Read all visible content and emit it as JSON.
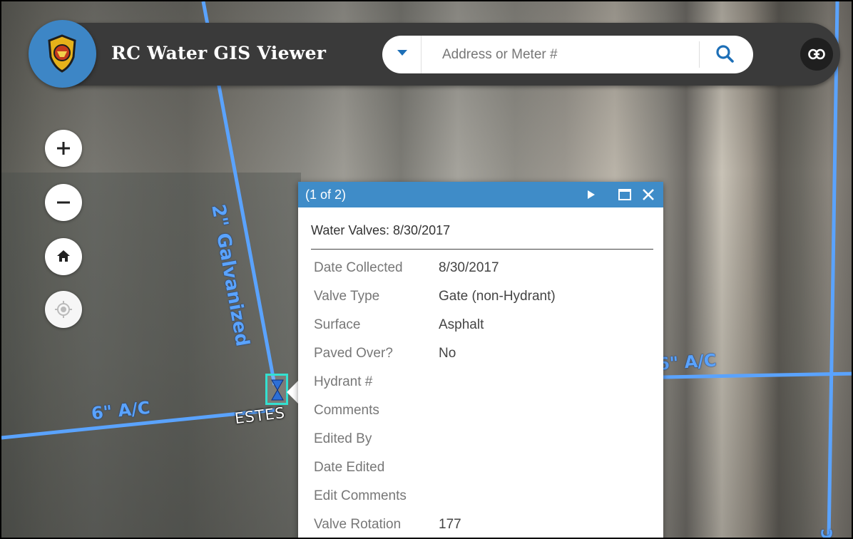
{
  "app": {
    "title": "RC Water GIS Viewer"
  },
  "search": {
    "placeholder": "Address or Meter #"
  },
  "map": {
    "pipe_labels": {
      "galvanized": "2\" Galvanized",
      "ac_left": "6\" A/C",
      "ac_right": "6\" A/C",
      "edge": "C"
    },
    "street_label": "ESTES",
    "pipe_color": "#5aa3ff"
  },
  "controls": {
    "zoom_in": "zoom-in",
    "zoom_out": "zoom-out",
    "home": "home",
    "locate": "locate"
  },
  "popup": {
    "count": "(1 of 2)",
    "title": "Water Valves: 8/30/2017",
    "header_color": "#3f8cc8",
    "attributes": [
      {
        "name": "Date Collected",
        "value": "8/30/2017"
      },
      {
        "name": "Valve Type",
        "value": "Gate (non-Hydrant)"
      },
      {
        "name": "Surface",
        "value": "Asphalt"
      },
      {
        "name": "Paved Over?",
        "value": "No"
      },
      {
        "name": "Hydrant #",
        "value": ""
      },
      {
        "name": "Comments",
        "value": ""
      },
      {
        "name": "Edited By",
        "value": ""
      },
      {
        "name": "Date Edited",
        "value": ""
      },
      {
        "name": "Edit Comments",
        "value": ""
      },
      {
        "name": "Valve Rotation",
        "value": "177"
      }
    ]
  },
  "colors": {
    "accent": "#3d86c6",
    "header_bar": "#3a3a3a",
    "marker": "#34e0d0"
  }
}
